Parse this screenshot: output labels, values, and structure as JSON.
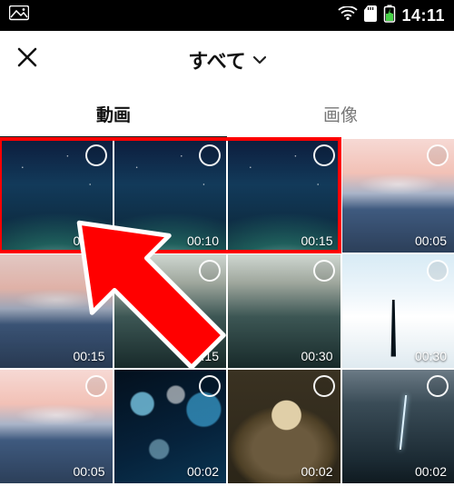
{
  "status": {
    "time": "14:11"
  },
  "header": {
    "title": "すべて"
  },
  "tabs": {
    "video": "動画",
    "image": "画像",
    "active": "video"
  },
  "grid": {
    "items": [
      {
        "kind": "galaxy",
        "duration": "00:05"
      },
      {
        "kind": "galaxy",
        "duration": "00:10"
      },
      {
        "kind": "galaxy",
        "duration": "00:15"
      },
      {
        "kind": "sunset",
        "duration": "00:05"
      },
      {
        "kind": "sunset",
        "duration": "00:15"
      },
      {
        "kind": "ocean",
        "duration": "00:15"
      },
      {
        "kind": "ocean",
        "duration": "00:30"
      },
      {
        "kind": "snow",
        "duration": "00:30"
      },
      {
        "kind": "sunset",
        "duration": "00:05"
      },
      {
        "kind": "bokeh",
        "duration": "00:02"
      },
      {
        "kind": "cat",
        "duration": "00:02"
      },
      {
        "kind": "storm",
        "duration": "00:02"
      }
    ]
  },
  "annotation": {
    "highlight_indices": [
      0,
      1,
      2
    ],
    "highlight_color": "#ff0000"
  }
}
